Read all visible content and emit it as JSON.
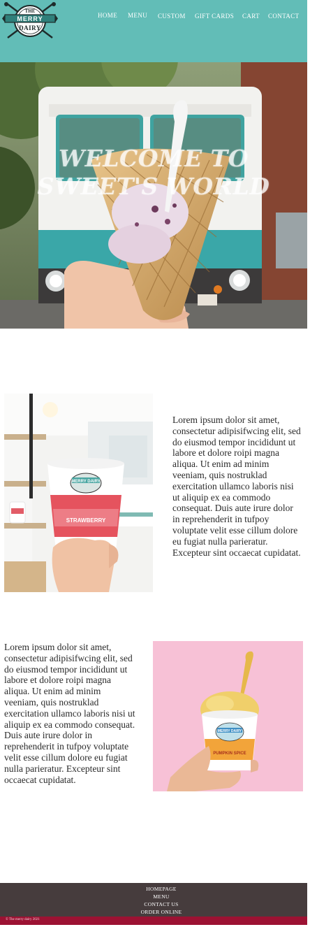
{
  "header": {
    "logo": {
      "line1": "THE",
      "line2": "MERRY",
      "line3": "DAIRY"
    },
    "nav": [
      "HOME",
      "MENU",
      "CUSTOM",
      "GIFT CARDS",
      "CART",
      "CONTACT"
    ]
  },
  "hero": {
    "title_line1": "WELCOME TO",
    "title_line2": "SWEET'S WORLD"
  },
  "section1": {
    "text": "Lorem ipsum dolor sit amet, consectetur adipisifwcing elit, sed do eiusmod tempor incididunt ut labore et dolore roipi magna aliqua. Ut enim ad minim veeniam, quis nostruklad exercitation ullamco laboris nisi ut aliquip ex ea commodo consequat. Duis aute irure dolor in reprehenderit in tufpoy voluptate velit esse cillum dolore eu fugiat nulla parieratur. Excepteur sint occaecat cupidatat.",
    "cup_label": "STRAWBERRY",
    "cup_brand": "MERRY DAIRY"
  },
  "section2": {
    "text": "Lorem ipsum dolor sit amet, consectetur adipisifwcing elit, sed do eiusmod tempor incididunt ut labore et dolore roipi magna aliqua. Ut enim ad minim veeniam, quis nostruklad exercitation ullamco laboris nisi ut aliquip ex ea commodo consequat. Duis aute irure dolor in reprehenderit in tufpoy voluptate velit esse cillum dolore eu fugiat nulla parieratur. Excepteur sint occaecat cupidatat.",
    "cup_label": "PUMPKIN SPICE",
    "cup_brand": "MERRY DAIRY"
  },
  "footer": {
    "links": [
      "HOMEPAGE",
      "MENU",
      "CONTACT US",
      "ORDER ONLINE"
    ],
    "copyright": "© The merry dairy 2021"
  },
  "colors": {
    "header_bg": "#62bdb7",
    "footer_bg": "#463c3d",
    "footer_bar": "#9c1233",
    "pink_bg": "#f7c1d6"
  }
}
